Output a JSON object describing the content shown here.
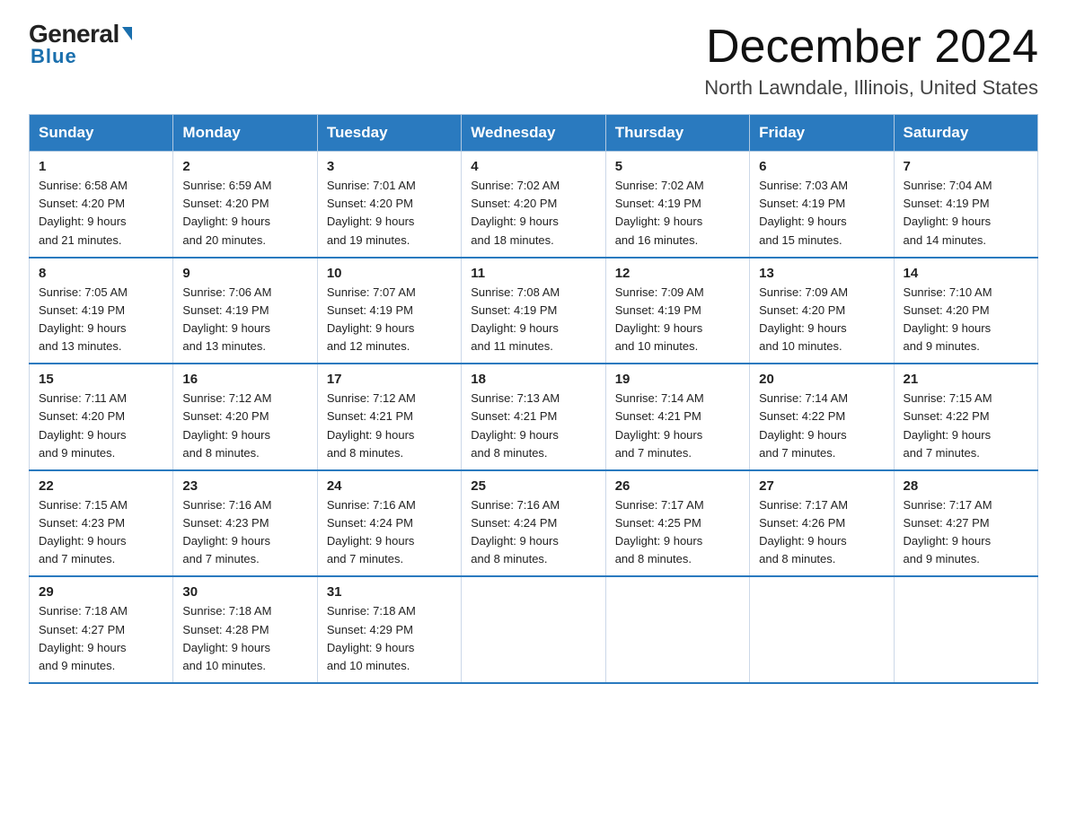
{
  "logo": {
    "general": "General",
    "blue": "Blue",
    "triangle": "▲"
  },
  "title": "December 2024",
  "location": "North Lawndale, Illinois, United States",
  "weekdays": [
    "Sunday",
    "Monday",
    "Tuesday",
    "Wednesday",
    "Thursday",
    "Friday",
    "Saturday"
  ],
  "weeks": [
    [
      {
        "day": "1",
        "sunrise": "6:58 AM",
        "sunset": "4:20 PM",
        "daylight": "9 hours and 21 minutes."
      },
      {
        "day": "2",
        "sunrise": "6:59 AM",
        "sunset": "4:20 PM",
        "daylight": "9 hours and 20 minutes."
      },
      {
        "day": "3",
        "sunrise": "7:01 AM",
        "sunset": "4:20 PM",
        "daylight": "9 hours and 19 minutes."
      },
      {
        "day": "4",
        "sunrise": "7:02 AM",
        "sunset": "4:20 PM",
        "daylight": "9 hours and 18 minutes."
      },
      {
        "day": "5",
        "sunrise": "7:02 AM",
        "sunset": "4:19 PM",
        "daylight": "9 hours and 16 minutes."
      },
      {
        "day": "6",
        "sunrise": "7:03 AM",
        "sunset": "4:19 PM",
        "daylight": "9 hours and 15 minutes."
      },
      {
        "day": "7",
        "sunrise": "7:04 AM",
        "sunset": "4:19 PM",
        "daylight": "9 hours and 14 minutes."
      }
    ],
    [
      {
        "day": "8",
        "sunrise": "7:05 AM",
        "sunset": "4:19 PM",
        "daylight": "9 hours and 13 minutes."
      },
      {
        "day": "9",
        "sunrise": "7:06 AM",
        "sunset": "4:19 PM",
        "daylight": "9 hours and 13 minutes."
      },
      {
        "day": "10",
        "sunrise": "7:07 AM",
        "sunset": "4:19 PM",
        "daylight": "9 hours and 12 minutes."
      },
      {
        "day": "11",
        "sunrise": "7:08 AM",
        "sunset": "4:19 PM",
        "daylight": "9 hours and 11 minutes."
      },
      {
        "day": "12",
        "sunrise": "7:09 AM",
        "sunset": "4:19 PM",
        "daylight": "9 hours and 10 minutes."
      },
      {
        "day": "13",
        "sunrise": "7:09 AM",
        "sunset": "4:20 PM",
        "daylight": "9 hours and 10 minutes."
      },
      {
        "day": "14",
        "sunrise": "7:10 AM",
        "sunset": "4:20 PM",
        "daylight": "9 hours and 9 minutes."
      }
    ],
    [
      {
        "day": "15",
        "sunrise": "7:11 AM",
        "sunset": "4:20 PM",
        "daylight": "9 hours and 9 minutes."
      },
      {
        "day": "16",
        "sunrise": "7:12 AM",
        "sunset": "4:20 PM",
        "daylight": "9 hours and 8 minutes."
      },
      {
        "day": "17",
        "sunrise": "7:12 AM",
        "sunset": "4:21 PM",
        "daylight": "9 hours and 8 minutes."
      },
      {
        "day": "18",
        "sunrise": "7:13 AM",
        "sunset": "4:21 PM",
        "daylight": "9 hours and 8 minutes."
      },
      {
        "day": "19",
        "sunrise": "7:14 AM",
        "sunset": "4:21 PM",
        "daylight": "9 hours and 7 minutes."
      },
      {
        "day": "20",
        "sunrise": "7:14 AM",
        "sunset": "4:22 PM",
        "daylight": "9 hours and 7 minutes."
      },
      {
        "day": "21",
        "sunrise": "7:15 AM",
        "sunset": "4:22 PM",
        "daylight": "9 hours and 7 minutes."
      }
    ],
    [
      {
        "day": "22",
        "sunrise": "7:15 AM",
        "sunset": "4:23 PM",
        "daylight": "9 hours and 7 minutes."
      },
      {
        "day": "23",
        "sunrise": "7:16 AM",
        "sunset": "4:23 PM",
        "daylight": "9 hours and 7 minutes."
      },
      {
        "day": "24",
        "sunrise": "7:16 AM",
        "sunset": "4:24 PM",
        "daylight": "9 hours and 7 minutes."
      },
      {
        "day": "25",
        "sunrise": "7:16 AM",
        "sunset": "4:24 PM",
        "daylight": "9 hours and 8 minutes."
      },
      {
        "day": "26",
        "sunrise": "7:17 AM",
        "sunset": "4:25 PM",
        "daylight": "9 hours and 8 minutes."
      },
      {
        "day": "27",
        "sunrise": "7:17 AM",
        "sunset": "4:26 PM",
        "daylight": "9 hours and 8 minutes."
      },
      {
        "day": "28",
        "sunrise": "7:17 AM",
        "sunset": "4:27 PM",
        "daylight": "9 hours and 9 minutes."
      }
    ],
    [
      {
        "day": "29",
        "sunrise": "7:18 AM",
        "sunset": "4:27 PM",
        "daylight": "9 hours and 9 minutes."
      },
      {
        "day": "30",
        "sunrise": "7:18 AM",
        "sunset": "4:28 PM",
        "daylight": "9 hours and 10 minutes."
      },
      {
        "day": "31",
        "sunrise": "7:18 AM",
        "sunset": "4:29 PM",
        "daylight": "9 hours and 10 minutes."
      },
      null,
      null,
      null,
      null
    ]
  ],
  "labels": {
    "sunrise": "Sunrise:",
    "sunset": "Sunset:",
    "daylight": "Daylight:"
  }
}
